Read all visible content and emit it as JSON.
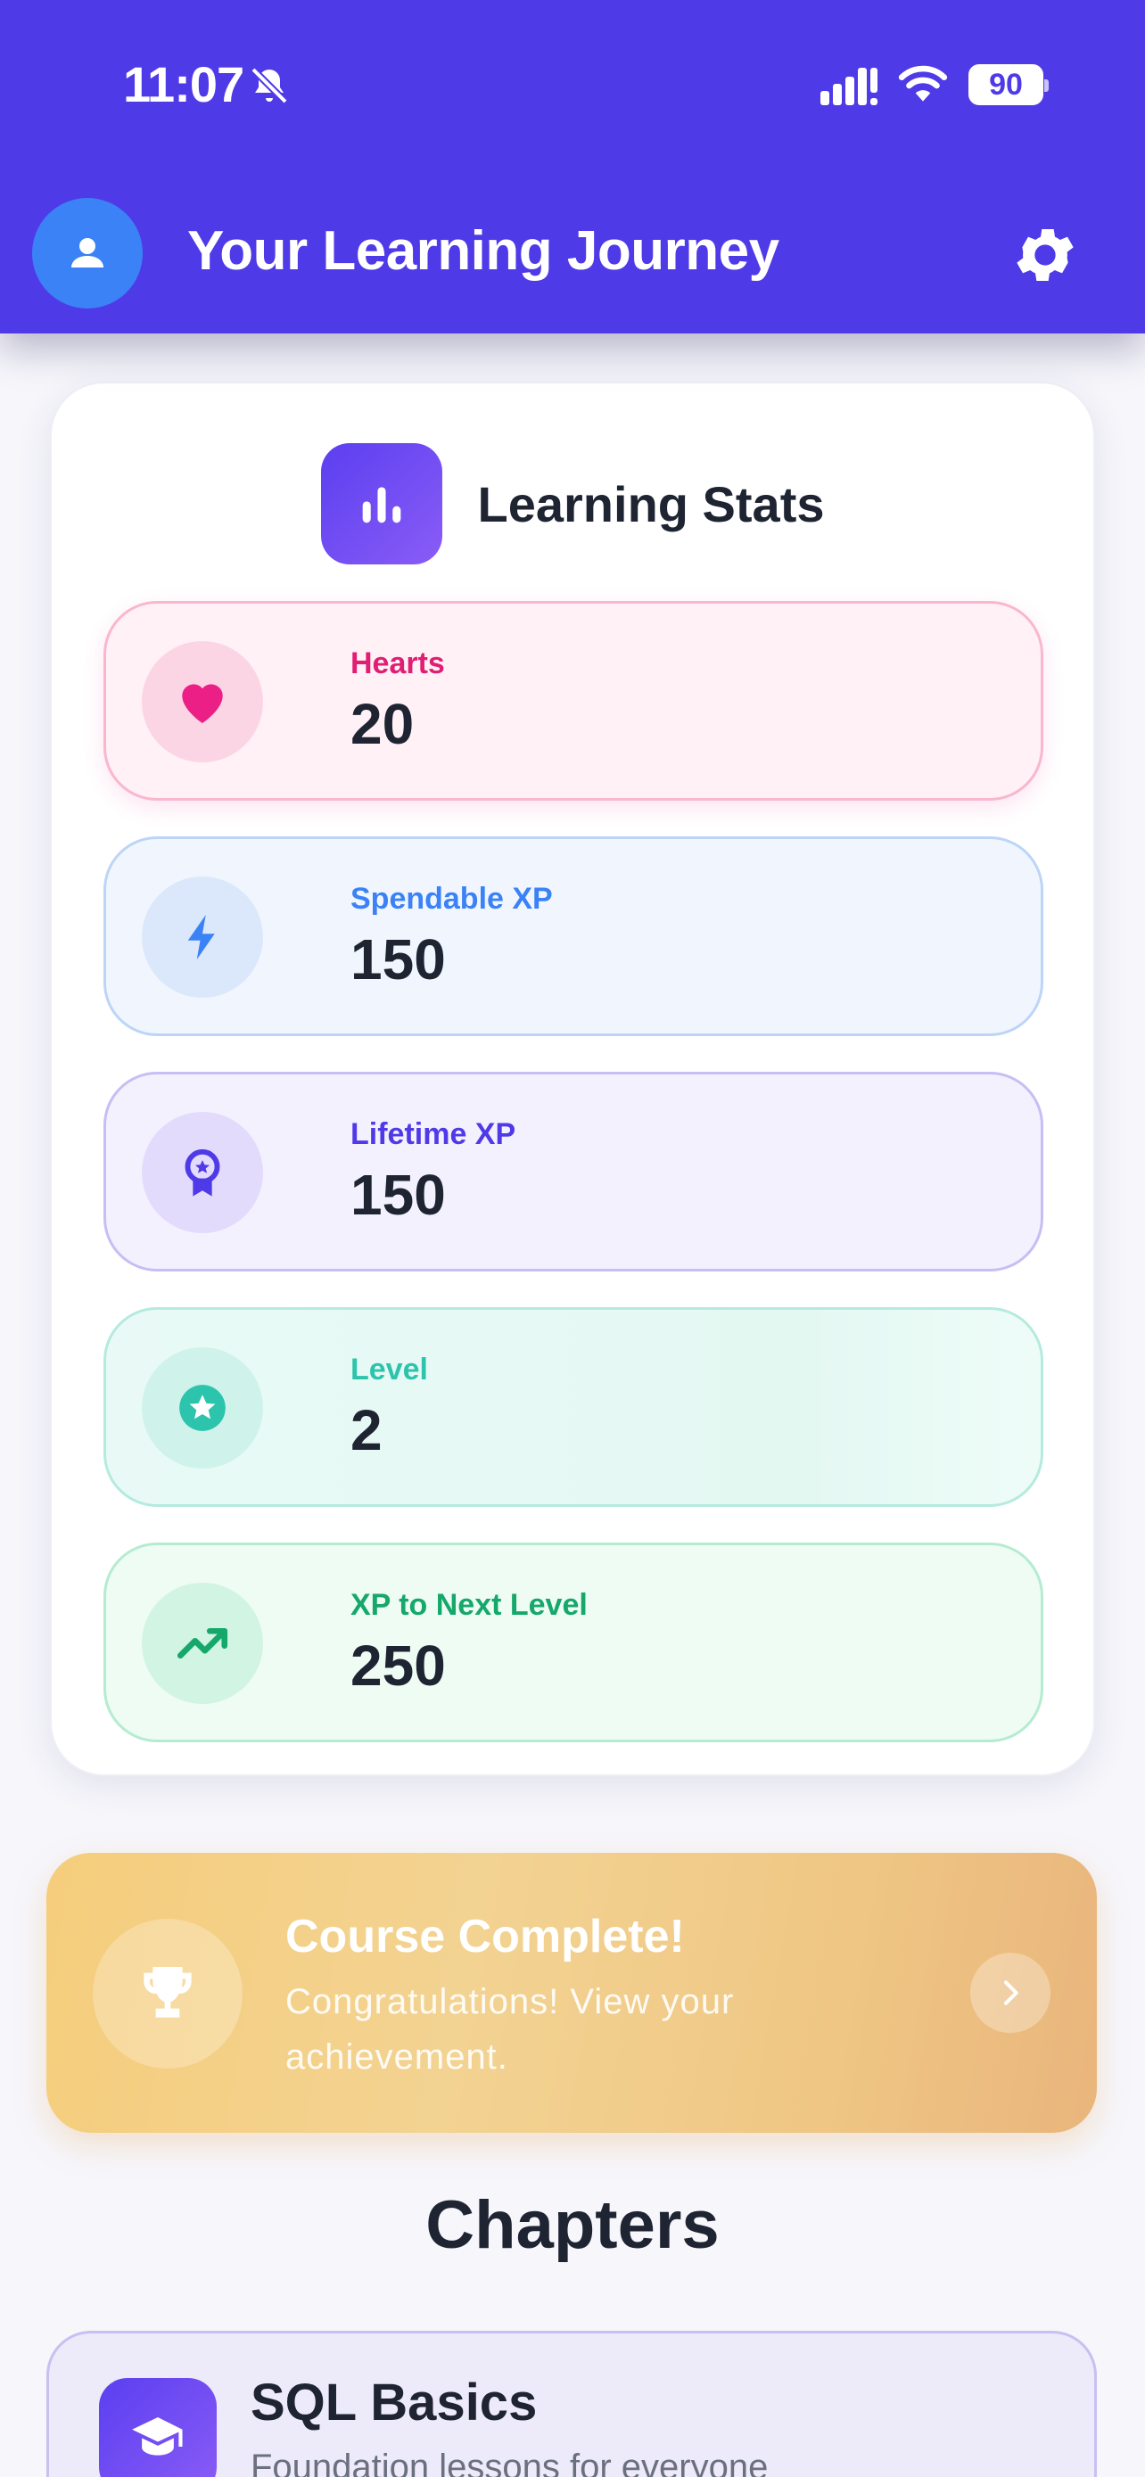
{
  "status_bar": {
    "time": "11:07",
    "battery": "90"
  },
  "header": {
    "title": "Your Learning Journey"
  },
  "stats": {
    "title": "Learning Stats",
    "items": [
      {
        "label": "Hearts",
        "value": "20",
        "icon": "heart-icon"
      },
      {
        "label": "Spendable XP",
        "value": "150",
        "icon": "lightning-icon"
      },
      {
        "label": "Lifetime XP",
        "value": "150",
        "icon": "award-icon"
      },
      {
        "label": "Level",
        "value": "2",
        "icon": "star-icon"
      },
      {
        "label": "XP to Next Level",
        "value": "250",
        "icon": "trending-up-icon"
      }
    ]
  },
  "complete": {
    "title": "Course Complete!",
    "subtitle": "Congratulations! View your achievement."
  },
  "chapters": {
    "title": "Chapters",
    "items": [
      {
        "title": "SQL Basics",
        "subtitle": "Foundation lessons for everyone"
      }
    ]
  },
  "colors": {
    "brand": "#4f3ae8",
    "hearts": "#ec4899",
    "spendable": "#3b82f6",
    "lifetime": "#4f3ae8",
    "level": "#2dc4ad",
    "next_level": "#16a86b",
    "complete_banner": "#f3d392"
  }
}
